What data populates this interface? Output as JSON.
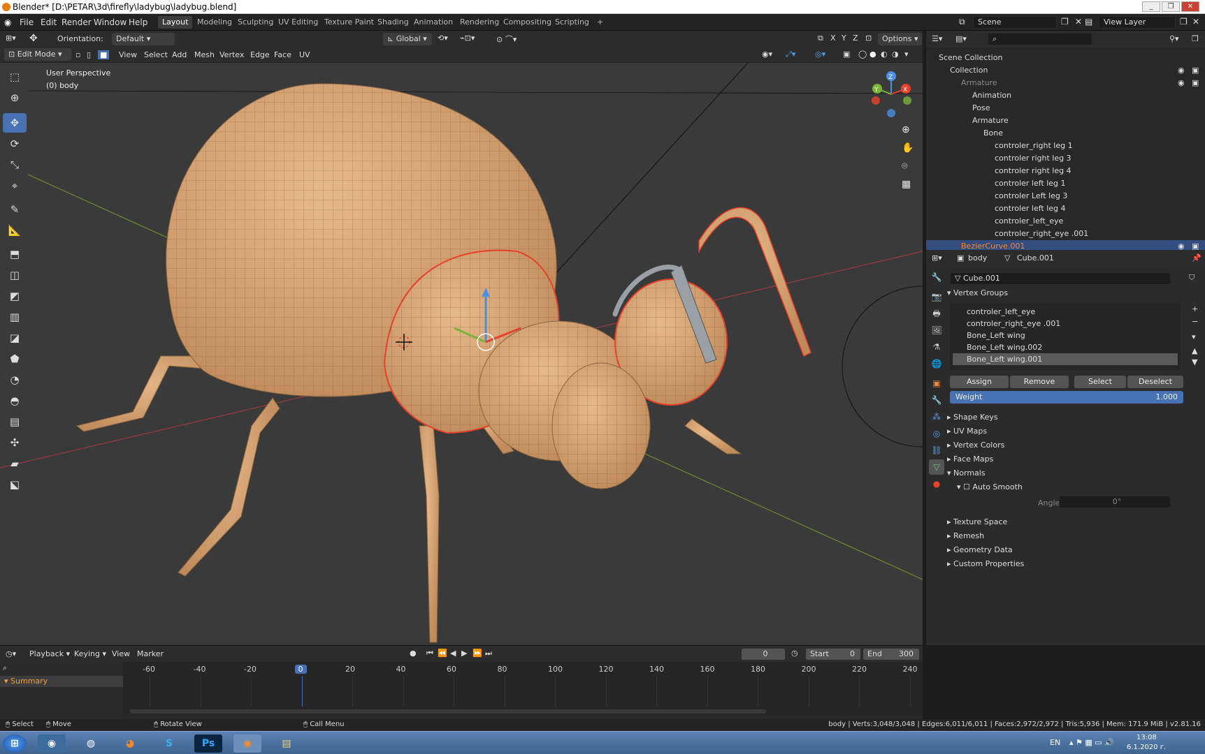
{
  "window": {
    "title": "Blender* [D:\\PETAR\\3d\\firefly\\ladybug\\ladybug.blend]"
  },
  "menu": [
    "File",
    "Edit",
    "Render",
    "Window",
    "Help"
  ],
  "workspaces": [
    "Layout",
    "Modeling",
    "Sculpting",
    "UV Editing",
    "Texture Paint",
    "Shading",
    "Animation",
    "Rendering",
    "Compositing",
    "Scripting"
  ],
  "scene": "Scene",
  "view_layer": "View Layer",
  "header": {
    "orientation_label": "Orientation:",
    "orientation_value": "Default",
    "transform": "Global",
    "options": "Options",
    "axes": [
      "X",
      "Y",
      "Z"
    ]
  },
  "editbar": {
    "mode": "Edit Mode",
    "menus": [
      "View",
      "Select",
      "Add",
      "Mesh",
      "Vertex",
      "Edge",
      "Face",
      "UV"
    ]
  },
  "viewport": {
    "perspective": "User Perspective",
    "object": "(0) body"
  },
  "gizmo": {
    "x": "X",
    "y": "Y",
    "z": "Z"
  },
  "outliner": {
    "search_placeholder": "",
    "rows": [
      {
        "label": "Scene Collection",
        "indent": 0,
        "color": "#ddd"
      },
      {
        "label": "Collection",
        "indent": 1,
        "color": "#ddd"
      },
      {
        "label": "Armature",
        "indent": 2,
        "color": "#888"
      },
      {
        "label": "Animation",
        "indent": 3,
        "color": "#ddd"
      },
      {
        "label": "Pose",
        "indent": 3,
        "color": "#ddd"
      },
      {
        "label": "Armature",
        "indent": 3,
        "color": "#ddd"
      },
      {
        "label": "Bone",
        "indent": 4,
        "color": "#ddd"
      },
      {
        "label": "controler_right leg 1",
        "indent": 5,
        "color": "#ddd"
      },
      {
        "label": "controler right leg 3",
        "indent": 5,
        "color": "#ddd"
      },
      {
        "label": "controler right leg 4",
        "indent": 5,
        "color": "#ddd"
      },
      {
        "label": "controler left leg 1",
        "indent": 5,
        "color": "#ddd"
      },
      {
        "label": "controler Left leg 3",
        "indent": 5,
        "color": "#ddd"
      },
      {
        "label": "controler left leg 4",
        "indent": 5,
        "color": "#ddd"
      },
      {
        "label": "controler_left_eye",
        "indent": 5,
        "color": "#ddd"
      },
      {
        "label": "controler_right_eye .001",
        "indent": 5,
        "color": "#ddd"
      },
      {
        "label": "BezierCurve.001",
        "indent": 2,
        "color": "#f08a3b"
      }
    ]
  },
  "props": {
    "object": "body",
    "mesh": "Cube.001",
    "datablock": "Cube.001",
    "vertex_groups_title": "Vertex Groups",
    "vertex_groups": [
      "controler_left_eye",
      "controler_right_eye .001",
      "Bone_Left wing",
      "Bone_Left wing.002",
      "Bone_Left wing.001"
    ],
    "buttons": [
      "Assign",
      "Remove",
      "Select",
      "Deselect"
    ],
    "weight_label": "Weight",
    "weight_value": "1.000",
    "panels": [
      "Shape Keys",
      "UV Maps",
      "Vertex Colors",
      "Face Maps"
    ],
    "normals": "Normals",
    "auto_smooth": "Auto Smooth",
    "angle_label": "Angle",
    "angle_value": "0°",
    "panels2": [
      "Texture Space",
      "Remesh",
      "Geometry Data",
      "Custom Properties"
    ]
  },
  "timeline": {
    "menus": [
      "Playback",
      "Keying",
      "View",
      "Marker"
    ],
    "current": "0",
    "start_label": "Start",
    "start": "0",
    "end_label": "End",
    "end": "300",
    "summary": "Summary",
    "ticks": [
      "-60",
      "-40",
      "-20",
      "0",
      "20",
      "40",
      "60",
      "80",
      "100",
      "120",
      "140",
      "160",
      "180",
      "200",
      "220",
      "240"
    ]
  },
  "status": {
    "select": "Select",
    "move": "Move",
    "rotate": "Rotate View",
    "menu": "Call Menu",
    "stats": "body | Verts:3,048/3,048 | Edges:6,011/6,011 | Faces:2,972/2,972 | Tris:5,936 | Mem: 171.9 MiB | v2.81.16"
  },
  "taskbar": {
    "lang": "EN",
    "time": "13:08",
    "date": "6.1.2020 г."
  },
  "colors": {
    "accent": "#4772b3",
    "mesh": "#d9a878",
    "selection": "#e8412a"
  }
}
